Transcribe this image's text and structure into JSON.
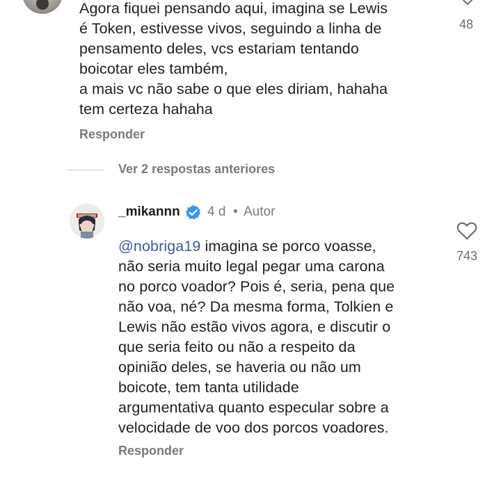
{
  "comment1": {
    "text_lines": [
      "Agora fiquei pensando aqui, imagina se Lewis",
      "é Token, estivesse vivos, seguindo a linha de",
      "pensamento deles, vcs estariam tentando",
      "boicotar eles também,",
      "a mais vc não sabe o que eles diriam, hahaha",
      "tem certeza hahaha"
    ],
    "like_count": "48",
    "reply_label": "Responder"
  },
  "thread": {
    "view_previous_label": "Ver 2 respostas anteriores"
  },
  "comment2": {
    "username": "_mikannn",
    "time": "4 d",
    "separator": "•",
    "author_label": "Autor",
    "mention": "@nobriga19",
    "text_first_line_rest": " imagina se porco voasse,",
    "text_lines": [
      "não seria muito legal pegar uma carona",
      "no porco voador? Pois é, seria, pena que",
      "não voa, né? Da mesma forma, Tolkien e",
      "Lewis não estão vivos agora, e discutir o",
      "que seria feito ou não a respeito da",
      "opinião deles, se haveria ou não um",
      "boicote, tem tanta utilidade",
      "argumentativa quanto especular sobre a",
      "velocidade de voo dos porcos voadores."
    ],
    "like_count": "743",
    "reply_label": "Responder"
  },
  "icons": {
    "heart": "heart-outline-icon",
    "verified": "verified-badge-icon"
  },
  "colors": {
    "mention": "#3e5c98",
    "verified": "#3897f0",
    "secondary_text": "#7a7a7a"
  }
}
